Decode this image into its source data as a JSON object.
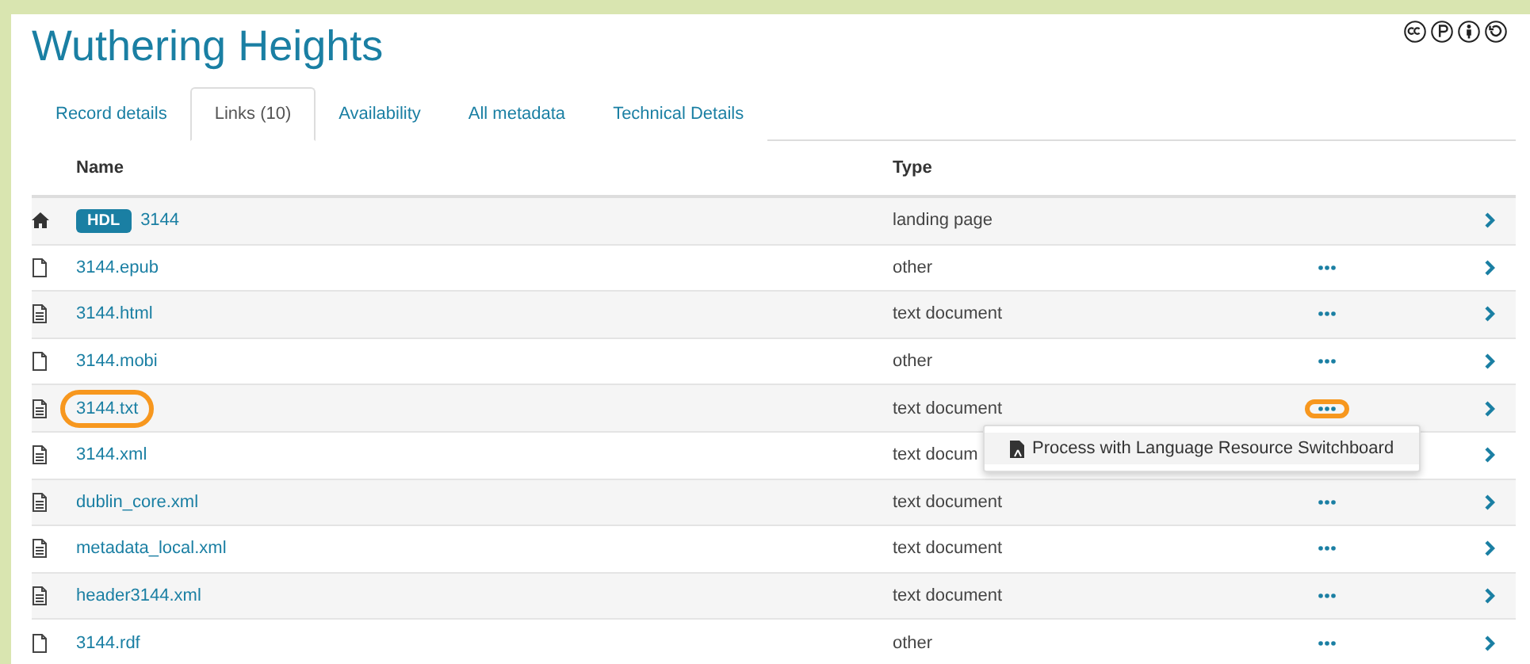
{
  "title": "Wuthering Heights",
  "tabs": [
    {
      "label": "Record details",
      "selected": false
    },
    {
      "label": "Links (10)",
      "selected": true
    },
    {
      "label": "Availability",
      "selected": false
    },
    {
      "label": "All metadata",
      "selected": false
    },
    {
      "label": "Technical Details",
      "selected": false
    }
  ],
  "table": {
    "columns": [
      "Name",
      "Type"
    ],
    "rows": [
      {
        "kind": "handle",
        "badge": "HDL",
        "name": "3144",
        "type": "landing page",
        "actions": false,
        "highlighted": false
      },
      {
        "kind": "file",
        "name": "3144.epub",
        "type": "other",
        "actions": true,
        "highlighted": false
      },
      {
        "kind": "document",
        "name": "3144.html",
        "type": "text document",
        "actions": true,
        "highlighted": false
      },
      {
        "kind": "file",
        "name": "3144.mobi",
        "type": "other",
        "actions": true,
        "highlighted": false
      },
      {
        "kind": "document",
        "name": "3144.txt",
        "type": "text document",
        "actions": true,
        "highlighted": true,
        "menu": {
          "item": "Process with Language Resource Switchboard"
        }
      },
      {
        "kind": "document",
        "name": "3144.xml",
        "type": "text docum",
        "actions": false,
        "highlighted": false
      },
      {
        "kind": "document",
        "name": "dublin_core.xml",
        "type": "text document",
        "actions": true,
        "highlighted": false
      },
      {
        "kind": "document",
        "name": "metadata_local.xml",
        "type": "text document",
        "actions": true,
        "highlighted": false
      },
      {
        "kind": "document",
        "name": "header3144.xml",
        "type": "text document",
        "actions": true,
        "highlighted": false
      },
      {
        "kind": "file",
        "name": "3144.rdf",
        "type": "other",
        "actions": true,
        "highlighted": false
      }
    ]
  }
}
